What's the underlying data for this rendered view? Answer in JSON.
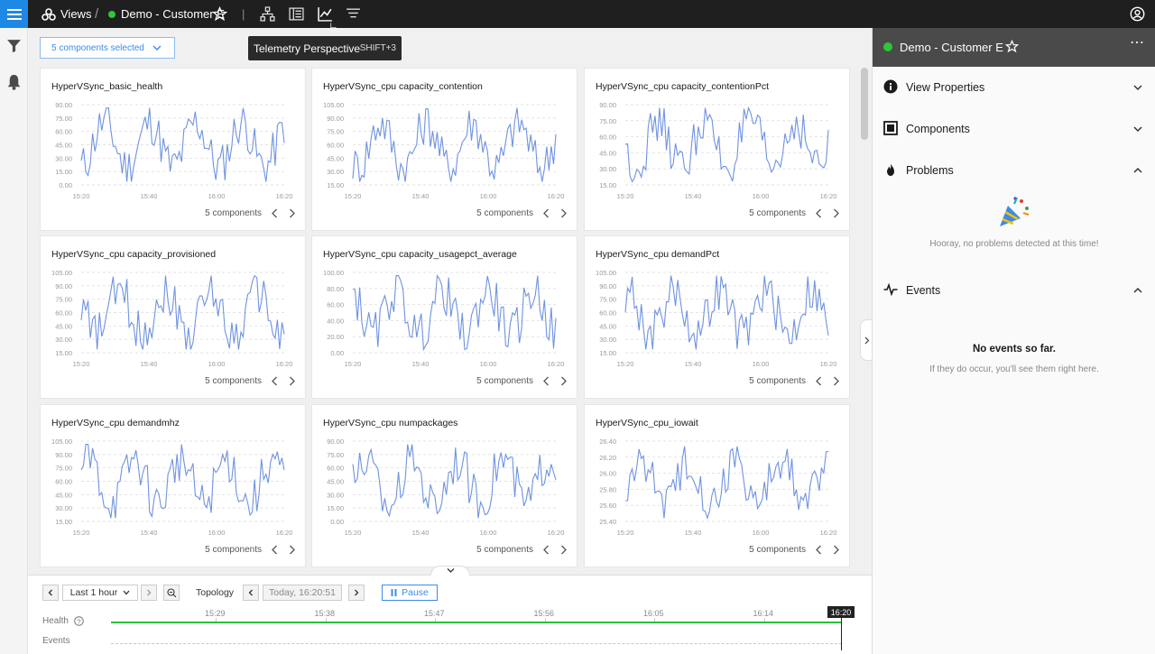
{
  "topbar": {
    "views_label": "Views",
    "breadcrumb_sep": "/",
    "view_name": "Demo - Customer E",
    "status_color": "#2ec73a",
    "accent": "#1e88e5"
  },
  "tooltip": {
    "label": "Telemetry Perspective",
    "shortcut": "SHIFT+3"
  },
  "component_select": {
    "label": "5 components selected"
  },
  "cards": [
    {
      "title": "HyperVSync_basic_health",
      "footer": "5 components",
      "y_ticks": [
        "90.00",
        "75.00",
        "60.00",
        "45.00",
        "30.00",
        "15.00",
        "0.00"
      ],
      "x_ticks": [
        "15:20",
        "15:40",
        "16:00",
        "16:20"
      ]
    },
    {
      "title": "HyperVSync_cpu capacity_contention",
      "footer": "5 components",
      "y_ticks": [
        "105.00",
        "90.00",
        "75.00",
        "60.00",
        "45.00",
        "30.00",
        "15.00"
      ],
      "x_ticks": [
        "15:20",
        "15:40",
        "16:00",
        "16:20"
      ]
    },
    {
      "title": "HyperVSync_cpu capacity_contentionPct",
      "footer": "5 components",
      "y_ticks": [
        "90.00",
        "75.00",
        "60.00",
        "45.00",
        "30.00",
        "15.00"
      ],
      "x_ticks": [
        "15:20",
        "15:40",
        "16:00",
        "16:20"
      ]
    },
    {
      "title": "HyperVSync_cpu capacity_provisioned",
      "footer": "5 components",
      "y_ticks": [
        "105.00",
        "90.00",
        "75.00",
        "60.00",
        "45.00",
        "30.00",
        "15.00"
      ],
      "x_ticks": [
        "15:20",
        "15:40",
        "16:00",
        "16:20"
      ]
    },
    {
      "title": "HyperVSync_cpu capacity_usagepct_average",
      "footer": "5 components",
      "y_ticks": [
        "100.00",
        "80.00",
        "60.00",
        "40.00",
        "20.00",
        "0.00"
      ],
      "x_ticks": [
        "15:20",
        "15:40",
        "16:00",
        "16:20"
      ]
    },
    {
      "title": "HyperVSync_cpu demandPct",
      "footer": "5 components",
      "y_ticks": [
        "105.00",
        "90.00",
        "75.00",
        "60.00",
        "45.00",
        "30.00",
        "15.00"
      ],
      "x_ticks": [
        "15:20",
        "15:40",
        "16:00",
        "16:20"
      ]
    },
    {
      "title": "HyperVSync_cpu demandmhz",
      "footer": "5 components",
      "y_ticks": [
        "105.00",
        "90.00",
        "75.00",
        "60.00",
        "45.00",
        "30.00",
        "15.00"
      ],
      "x_ticks": [
        "15:20",
        "15:40",
        "16:00",
        "16:20"
      ]
    },
    {
      "title": "HyperVSync_cpu numpackages",
      "footer": "5 components",
      "y_ticks": [
        "90.00",
        "75.00",
        "60.00",
        "45.00",
        "30.00",
        "15.00",
        "0.00"
      ],
      "x_ticks": [
        "15:20",
        "15:40",
        "16:00",
        "16:20"
      ]
    },
    {
      "title": "HyperVSync_cpu_iowait",
      "footer": "5 components",
      "y_ticks": [
        "26.40",
        "26.20",
        "26.00",
        "25.80",
        "25.60",
        "25.40"
      ],
      "x_ticks": [
        "15:20",
        "15:40",
        "16:00",
        "16:20"
      ]
    }
  ],
  "right_panel": {
    "title": "Demo - Customer E",
    "sections": {
      "view_properties": "View Properties",
      "components": "Components",
      "problems": "Problems",
      "events": "Events"
    },
    "problems_empty": "Hooray, no problems detected at this time!",
    "events_empty_title": "No events so far.",
    "events_empty_sub": "If they do occur, you'll see them right here."
  },
  "timeline": {
    "range": "Last 1 hour",
    "mode": "Topology",
    "timestamp": "Today, 16:20:51",
    "pause_label": "Pause",
    "health_label": "Health",
    "events_label": "Events",
    "ticks": [
      "15:29",
      "15:38",
      "15:47",
      "15:56",
      "16:05",
      "16:14"
    ],
    "now_marker": "16:20",
    "health_color": "#28c23a"
  }
}
